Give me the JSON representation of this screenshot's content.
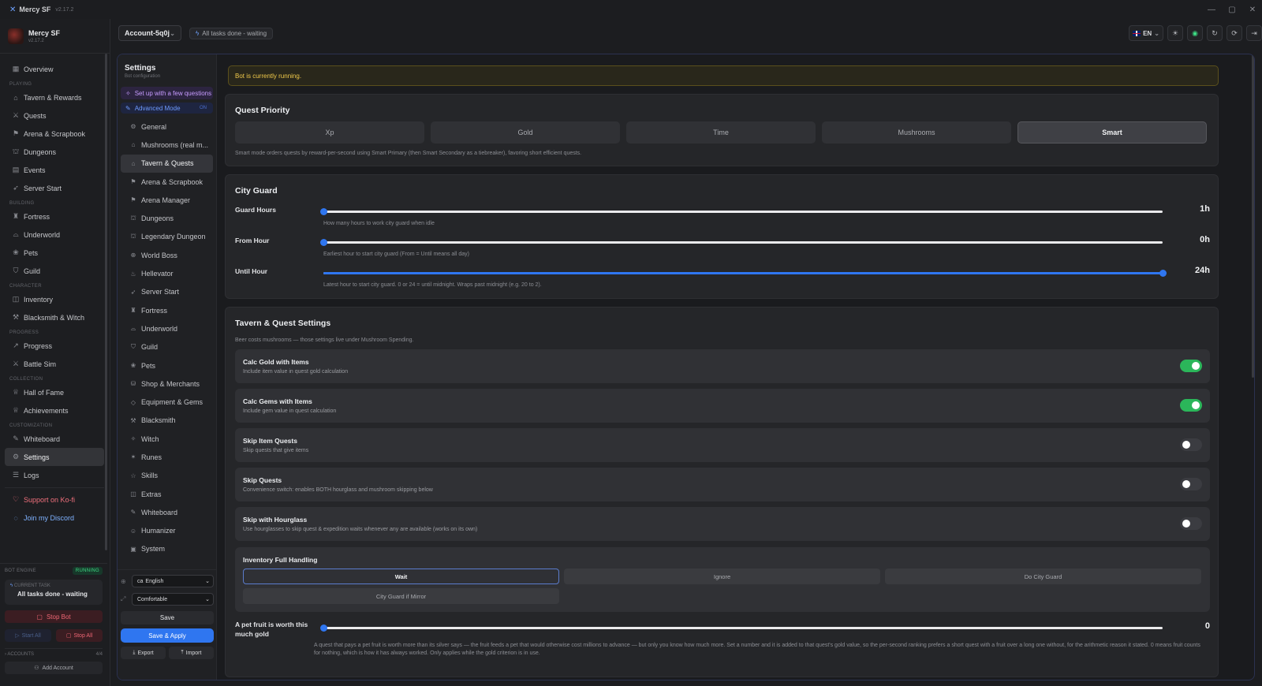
{
  "app": {
    "title": "Mercy SF",
    "version": "v2.17.2"
  },
  "brand": {
    "name": "Mercy SF",
    "version": "v2.17.2"
  },
  "window_controls": [
    "—",
    "▢",
    "✕"
  ],
  "sidebar": {
    "items": [
      {
        "type": "item",
        "label": "Overview",
        "icon": "grid-icon"
      },
      {
        "type": "section",
        "label": "PLAYING"
      },
      {
        "type": "item",
        "label": "Tavern & Rewards",
        "icon": "tavern-icon"
      },
      {
        "type": "item",
        "label": "Quests",
        "icon": "swords-icon"
      },
      {
        "type": "item",
        "label": "Arena & Scrapbook",
        "icon": "arena-icon"
      },
      {
        "type": "item",
        "label": "Dungeons",
        "icon": "dungeon-icon"
      },
      {
        "type": "item",
        "label": "Events",
        "icon": "calendar-icon"
      },
      {
        "type": "item",
        "label": "Server Start",
        "icon": "rocket-icon"
      },
      {
        "type": "section",
        "label": "BUILDING"
      },
      {
        "type": "item",
        "label": "Fortress",
        "icon": "castle-icon"
      },
      {
        "type": "item",
        "label": "Underworld",
        "icon": "underworld-icon"
      },
      {
        "type": "item",
        "label": "Pets",
        "icon": "paw-icon"
      },
      {
        "type": "item",
        "label": "Guild",
        "icon": "shield-icon"
      },
      {
        "type": "section",
        "label": "CHARACTER"
      },
      {
        "type": "item",
        "label": "Inventory",
        "icon": "box-icon"
      },
      {
        "type": "item",
        "label": "Blacksmith & Witch",
        "icon": "hammer-icon"
      },
      {
        "type": "section",
        "label": "PROGRESS"
      },
      {
        "type": "item",
        "label": "Progress",
        "icon": "trend-icon"
      },
      {
        "type": "item",
        "label": "Battle Sim",
        "icon": "swords-icon"
      },
      {
        "type": "section",
        "label": "COLLECTION"
      },
      {
        "type": "item",
        "label": "Hall of Fame",
        "icon": "trophy-icon"
      },
      {
        "type": "item",
        "label": "Achievements",
        "icon": "trophy-icon"
      },
      {
        "type": "section",
        "label": "CUSTOMIZATION"
      },
      {
        "type": "item",
        "label": "Whiteboard",
        "icon": "pen-icon"
      },
      {
        "type": "item",
        "label": "Settings",
        "icon": "gear-icon",
        "active": true
      },
      {
        "type": "item",
        "label": "Logs",
        "icon": "log-icon"
      },
      {
        "type": "gap"
      },
      {
        "type": "item",
        "label": "Support on Ko-fi",
        "icon": "heart-icon",
        "style": "kofi"
      },
      {
        "type": "item",
        "label": "Join my Discord",
        "icon": "chat-icon",
        "style": "disc"
      }
    ],
    "engine": {
      "label": "BOT ENGINE",
      "status": "RUNNING",
      "current_task_label": "CURRENT TASK",
      "current_task": "All tasks done - waiting",
      "stop_bot": "Stop Bot",
      "start_all": "Start All",
      "stop_all": "Stop All",
      "accounts_label": "ACCOUNTS",
      "accounts_count": "4/4",
      "add_account": "Add Account"
    }
  },
  "topbar": {
    "account": "Account-5q0j",
    "task_status": "All tasks done - waiting",
    "lang": "EN"
  },
  "settings_nav": {
    "title": "Settings",
    "subtitle": "Bot configuration",
    "setup": "Set up with a few questions",
    "advanced": "Advanced Mode",
    "advanced_state": "ON",
    "items": [
      {
        "label": "General",
        "icon": "gear-icon"
      },
      {
        "label": "Mushrooms (real m...",
        "icon": "mushroom-icon"
      },
      {
        "label": "Tavern & Quests",
        "icon": "tavern-icon",
        "active": true
      },
      {
        "label": "Arena & Scrapbook",
        "icon": "arena-icon"
      },
      {
        "label": "Arena Manager",
        "icon": "arena-icon"
      },
      {
        "label": "Dungeons",
        "icon": "dungeon-icon"
      },
      {
        "label": "Legendary Dungeon",
        "icon": "dungeon-icon"
      },
      {
        "label": "World Boss",
        "icon": "globe-icon"
      },
      {
        "label": "Hellevator",
        "icon": "fire-icon"
      },
      {
        "label": "Server Start",
        "icon": "rocket-icon"
      },
      {
        "label": "Fortress",
        "icon": "castle-icon"
      },
      {
        "label": "Underworld",
        "icon": "underworld-icon"
      },
      {
        "label": "Guild",
        "icon": "shield-icon"
      },
      {
        "label": "Pets",
        "icon": "paw-icon"
      },
      {
        "label": "Shop & Merchants",
        "icon": "shop-icon"
      },
      {
        "label": "Equipment & Gems",
        "icon": "gem-icon"
      },
      {
        "label": "Blacksmith",
        "icon": "hammer-icon"
      },
      {
        "label": "Witch",
        "icon": "wand-icon"
      },
      {
        "label": "Runes",
        "icon": "rune-icon"
      },
      {
        "label": "Skills",
        "icon": "star-icon"
      },
      {
        "label": "Extras",
        "icon": "box-icon"
      },
      {
        "label": "Whiteboard",
        "icon": "pen-icon"
      },
      {
        "label": "Humanizer",
        "icon": "user-icon"
      },
      {
        "label": "System",
        "icon": "cpu-icon"
      }
    ],
    "language_value": "English",
    "language_flag": "ca",
    "density_value": "Comfortable",
    "save": "Save",
    "save_apply": "Save & Apply",
    "export": "Export",
    "import": "Import"
  },
  "notice": "Bot is currently running.",
  "quest_priority": {
    "title": "Quest Priority",
    "options": [
      "Xp",
      "Gold",
      "Time",
      "Mushrooms",
      "Smart"
    ],
    "selected": "Smart",
    "note": "Smart mode orders quests by reward-per-second using Smart Primary (then Smart Secondary as a tiebreaker), favoring short efficient quests."
  },
  "city_guard": {
    "title": "City Guard",
    "sliders": [
      {
        "label": "Guard Hours",
        "value": "1h",
        "level": 0,
        "hint": "How many hours to work city guard when idle"
      },
      {
        "label": "From Hour",
        "value": "0h",
        "level": 0,
        "hint": "Earliest hour to start city guard (From = Until means all day)"
      },
      {
        "label": "Until Hour",
        "value": "24h",
        "level": 1,
        "hint": "Latest hour to start city guard. 0 or 24 = until midnight. Wraps past midnight (e.g. 20 to 2)."
      }
    ]
  },
  "tavern": {
    "title": "Tavern & Quest Settings",
    "subtitle": "Beer costs mushrooms — those settings live under Mushroom Spending.",
    "toggles": [
      {
        "title": "Calc Gold with Items",
        "desc": "Include item value in quest gold calculation",
        "on": true
      },
      {
        "title": "Calc Gems with Items",
        "desc": "Include gem value in quest calculation",
        "on": true
      },
      {
        "title": "Skip Item Quests",
        "desc": "Skip quests that give items",
        "on": false
      },
      {
        "title": "Skip Quests",
        "desc": "Convenience switch: enables BOTH hourglass and mushroom skipping below",
        "on": false
      },
      {
        "title": "Skip with Hourglass",
        "desc": "Use hourglasses to skip quest & expedition waits whenever any are available (works on its own)",
        "on": false
      }
    ],
    "inventory": {
      "title": "Inventory Full Handling",
      "options": [
        "Wait",
        "Ignore",
        "Do City Guard",
        "City Guard if Mirror"
      ],
      "selected": "Wait"
    },
    "pet_fruit": {
      "label": "A pet fruit is worth this much gold",
      "value": "0",
      "level": 0,
      "desc": "A quest that pays a pet fruit is worth more than its silver says — the fruit feeds a pet that would otherwise cost millions to advance — but only you know how much more. Set a number and it is added to that quest's gold value, so the per-second ranking prefers a short quest with a fruit over a long one without, for the arithmetic reason it stated. 0 means fruit counts for nothing, which is how it has always worked. Only applies while the gold criterion is in use."
    }
  }
}
